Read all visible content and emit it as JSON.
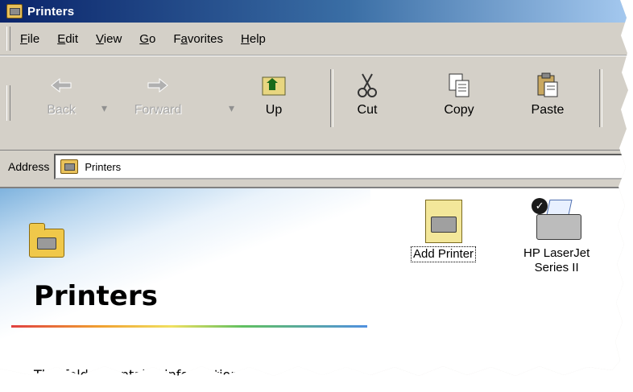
{
  "window": {
    "title": "Printers"
  },
  "menu": {
    "items": [
      {
        "key": "F",
        "rest": "ile"
      },
      {
        "key": "E",
        "rest": "dit"
      },
      {
        "key": "V",
        "rest": "iew"
      },
      {
        "key": "G",
        "rest": "o"
      },
      {
        "pre": "F",
        "key": "a",
        "rest": "vorites"
      },
      {
        "key": "H",
        "rest": "elp"
      }
    ]
  },
  "toolbar": {
    "back_label": "Back",
    "forward_label": "Forward",
    "up_label": "Up",
    "cut_label": "Cut",
    "copy_label": "Copy",
    "paste_label": "Paste"
  },
  "address": {
    "label": "Address",
    "value": "Printers"
  },
  "sidepanel": {
    "title": "Printers",
    "description": "This folder contains information"
  },
  "items": {
    "add_printer": "Add Printer",
    "laserjet_line1": "HP LaserJet",
    "laserjet_line2": "Series II"
  },
  "colors": {
    "titlebar_start": "#0a246a",
    "titlebar_end": "#a6caf0",
    "chrome": "#d4d0c8"
  }
}
